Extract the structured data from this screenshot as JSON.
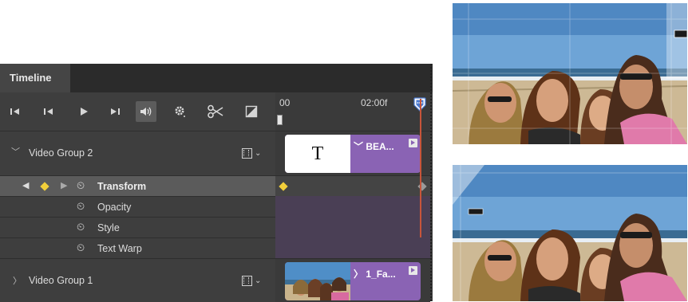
{
  "panel": {
    "tab_label": "Timeline"
  },
  "ruler": {
    "start_label": "00",
    "time_label": "02:00f"
  },
  "layers": {
    "video_group_2": {
      "label": "Video Group 2",
      "clip_thumb_glyph": "T",
      "clip_title": "BEA..."
    },
    "transform": {
      "label": "Transform"
    },
    "opacity": {
      "label": "Opacity"
    },
    "style": {
      "label": "Style"
    },
    "text_warp": {
      "label": "Text Warp"
    },
    "video_group_1": {
      "label": "Video Group 1",
      "clip_title": "1_Fa..."
    }
  },
  "icons": {
    "controls": [
      "go-to-first-frame-icon",
      "previous-frame-icon",
      "play-icon",
      "next-frame-icon",
      "audio-icon",
      "settings-icon",
      "split-icon",
      "transition-icon"
    ],
    "layer": [
      "disclosure-icon",
      "keyframe-nav-icon",
      "stopwatch-icon",
      "filmstrip-icon",
      "chevron-down-icon"
    ]
  },
  "colors": {
    "panel_bg": "#3a3a3a",
    "clip_purple": "#8a63b4",
    "playhead": "#c8553a",
    "playhead_head": "#4a7ad0",
    "keyframe": "#f2cf3a"
  }
}
